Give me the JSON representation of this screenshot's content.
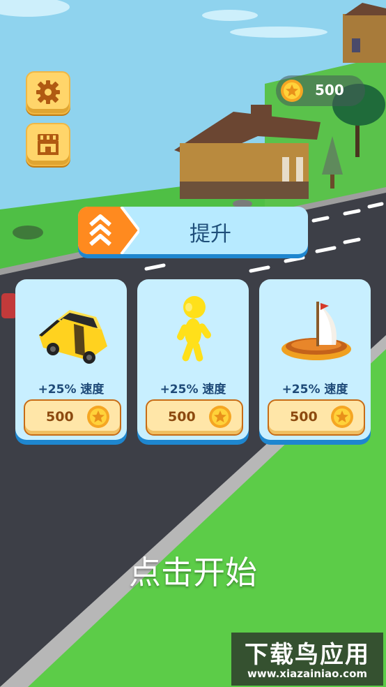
{
  "hud": {
    "coins": "500"
  },
  "upgrade": {
    "title": "提升"
  },
  "cards": [
    {
      "name": "car",
      "bonus": "+25%",
      "stat": "速度",
      "price": "500"
    },
    {
      "name": "runner",
      "bonus": "+25%",
      "stat": "速度",
      "price": "500"
    },
    {
      "name": "boat",
      "bonus": "+25%",
      "stat": "速度",
      "price": "500"
    }
  ],
  "prompt": {
    "tap_to_start": "点击开始"
  },
  "watermark": {
    "line1": "下载鸟应用",
    "line2": "www.xiazainiao.com"
  },
  "icons": {
    "settings": "gear-icon",
    "shop": "shop-icon",
    "coin": "star-coin-icon",
    "upgrade": "chevrons-up-icon"
  },
  "colors": {
    "button_gold": "#ffd56a",
    "card_bg": "#c8efff",
    "card_shadow": "#1e86cf",
    "price_text": "#8c4a10",
    "label_text": "#1e4a78"
  }
}
